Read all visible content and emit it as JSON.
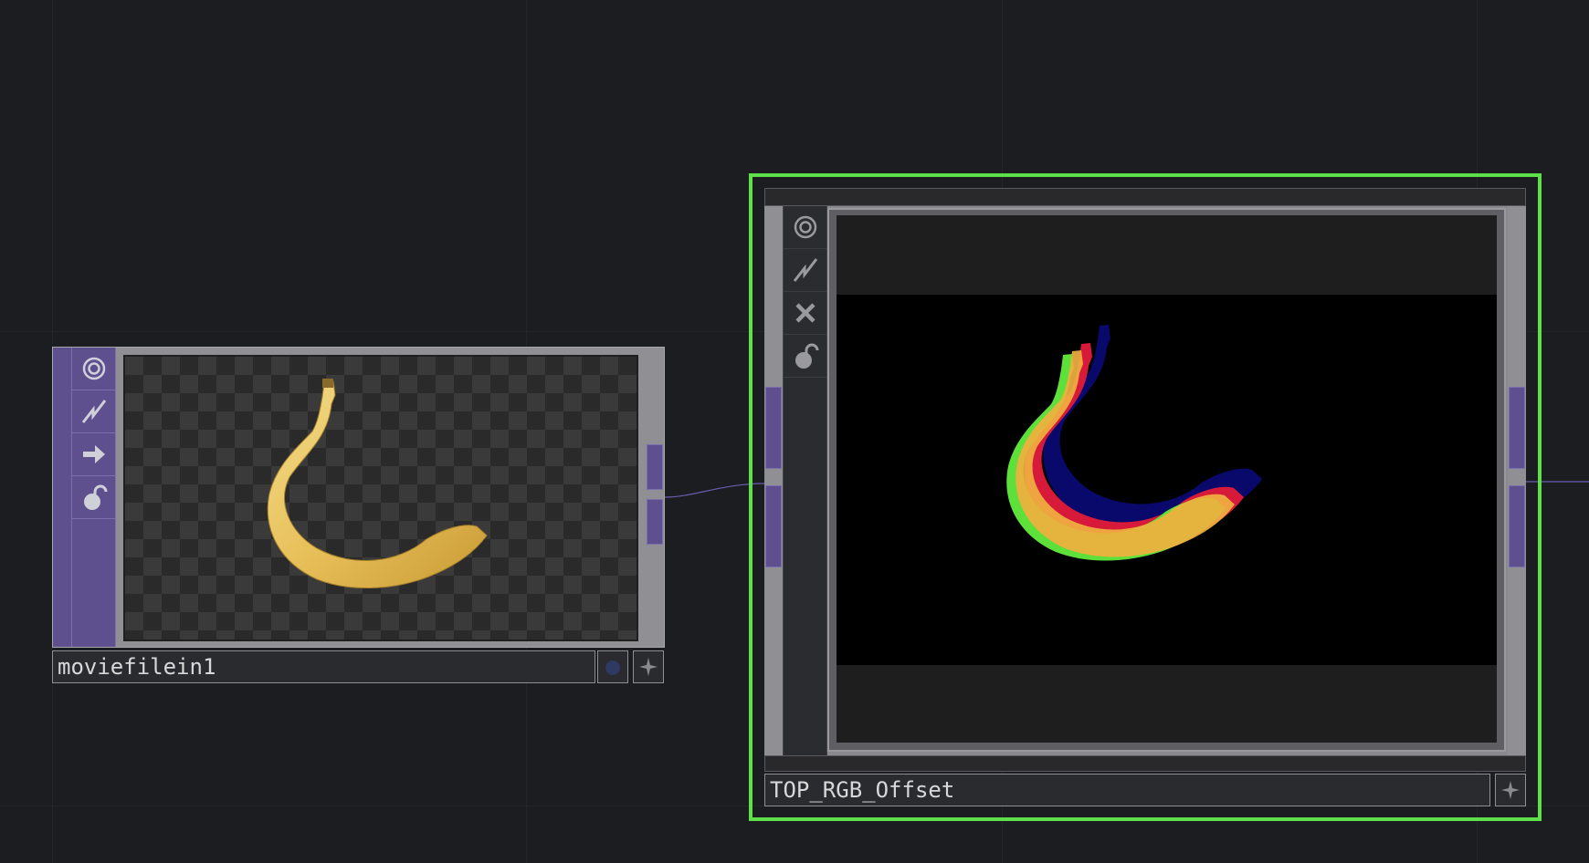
{
  "canvas": {
    "background": "#1c1d21",
    "wire_color": "#5e4f8f",
    "selection_color": "#5de04a"
  },
  "nodes": [
    {
      "name": "moviefilein1",
      "family_color": "#5e4f8f",
      "viewer_content": "banana image on transparent checkerboard",
      "buttons": [
        "viewer-icon",
        "cook-icon",
        "bypass-arrow-icon",
        "lock-icon"
      ]
    },
    {
      "name": "TOP_RGB_Offset",
      "selected": true,
      "viewer_content": "banana with red, green and blue channels offset",
      "buttons": [
        "viewer-icon",
        "cook-icon",
        "close-icon",
        "lock-icon"
      ]
    }
  ]
}
